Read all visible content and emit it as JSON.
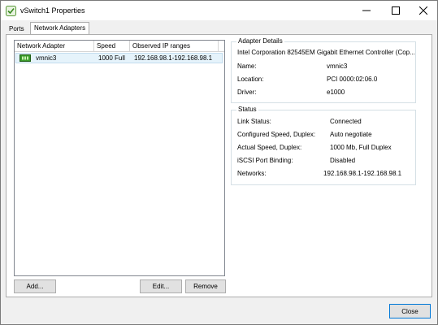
{
  "window": {
    "title": "vSwitch1 Properties",
    "icon": "vsphere-properties-icon"
  },
  "tabs": [
    {
      "label": "Ports",
      "active": false
    },
    {
      "label": "Network Adapters",
      "active": true
    }
  ],
  "adapter_list": {
    "columns": [
      "Network Adapter",
      "Speed",
      "Observed IP ranges"
    ],
    "rows": [
      {
        "adapter": "vmnic3",
        "speed": "1000 Full",
        "ip_ranges": "192.168.98.1-192.168.98.1",
        "icon": "nic-icon",
        "selected": true
      }
    ]
  },
  "buttons": {
    "add": "Add...",
    "edit": "Edit...",
    "remove": "Remove",
    "close": "Close"
  },
  "adapter_details": {
    "title": "Adapter Details",
    "description": "Intel Corporation 82545EM Gigabit Ethernet Controller (Cop...",
    "name_label": "Name:",
    "name_value": "vmnic3",
    "location_label": "Location:",
    "location_value": "PCI 0000:02:06.0",
    "driver_label": "Driver:",
    "driver_value": "e1000"
  },
  "status": {
    "title": "Status",
    "link_status_label": "Link Status:",
    "link_status_value": "Connected",
    "configured_speed_label": "Configured Speed, Duplex:",
    "configured_speed_value": "Auto negotiate",
    "actual_speed_label": "Actual Speed, Duplex:",
    "actual_speed_value": "1000 Mb, Full Duplex",
    "iscsi_label": "iSCSI Port Binding:",
    "iscsi_value": "Disabled",
    "networks_label": "Networks:",
    "networks_value": "192.168.98.1-192.168.98.1"
  },
  "colors": {
    "selection_bg": "#e5f3fb",
    "selection_border": "#c3dcee",
    "button_bg": "#e1e1e1",
    "window_bg": "#f0f0f0",
    "nic_green": "#3a9b2a"
  }
}
